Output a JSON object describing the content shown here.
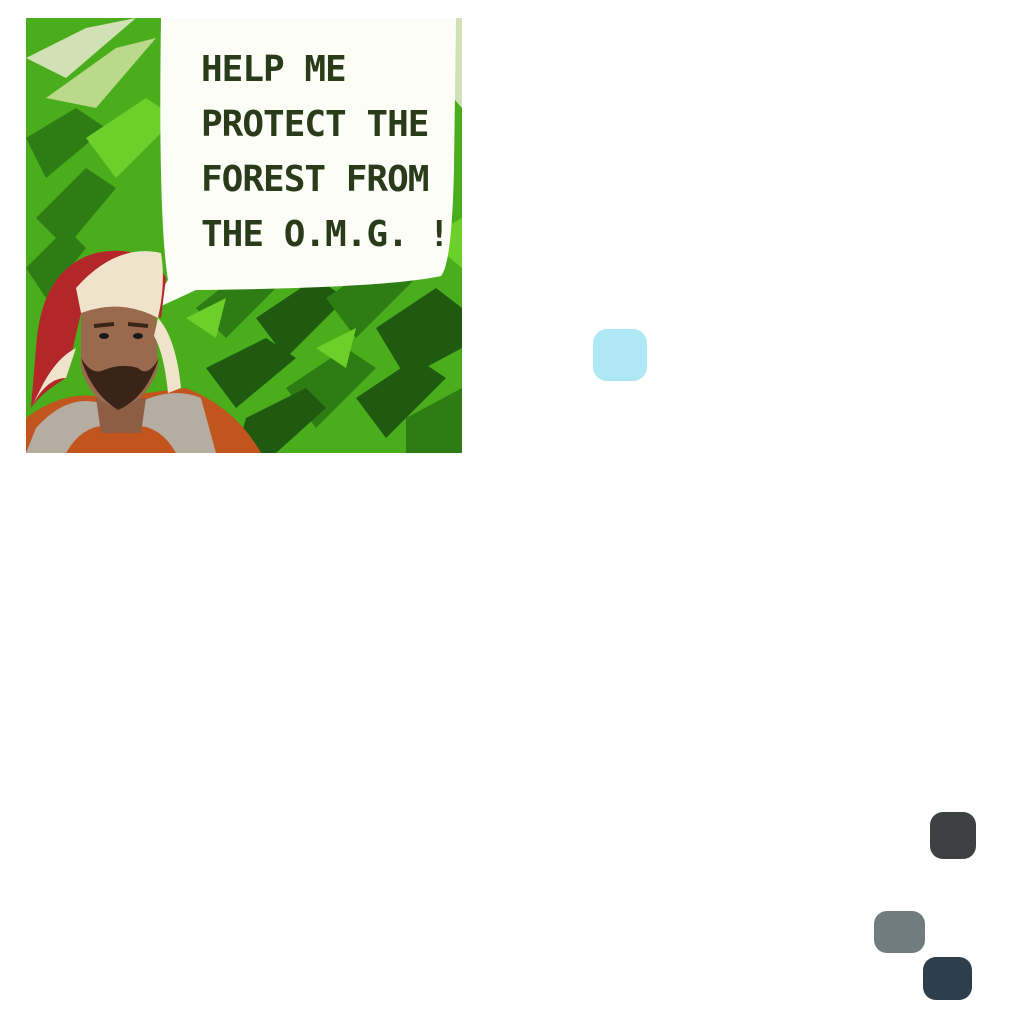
{
  "comic_panel": {
    "speech_text": "HELP ME\nPROTECT THE\nFOREST FROM\nTHE O.M.G. !",
    "text_color": "#2a3b1a",
    "bubble_color": "#fdfdf8",
    "foliage_colors": [
      "#3fa21c",
      "#5cbf20",
      "#2e7d14",
      "#1f5a10"
    ],
    "character": "bearded-lumberjack-with-trapper-hat"
  },
  "color_swatches": [
    {
      "name": "light-blue",
      "color": "#aee8f5"
    },
    {
      "name": "charcoal",
      "color": "#3e4142"
    },
    {
      "name": "gray",
      "color": "#717c7f"
    },
    {
      "name": "navy",
      "color": "#2f3e4b"
    }
  ]
}
